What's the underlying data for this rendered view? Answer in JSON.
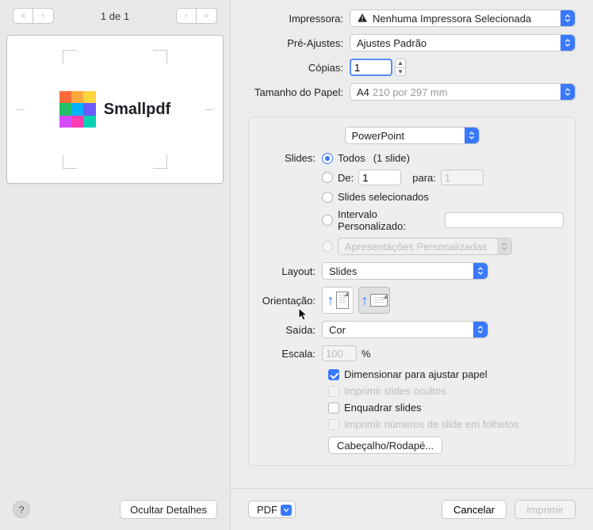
{
  "left": {
    "page_counter": "1 de 1",
    "brand": "Smallpdf",
    "logo_colors": [
      "#ff6a3d",
      "#ffa83d",
      "#ffd53d",
      "#22c06b",
      "#00b1ff",
      "#6a5cff",
      "#d64aff",
      "#ff3db0",
      "#00d1b2"
    ],
    "hide_details": "Ocultar Detalhes",
    "help": "?"
  },
  "printer": {
    "label": "Impressora:",
    "value": "Nenhuma Impressora Selecionada",
    "warning": true
  },
  "presets": {
    "label": "Pré-Ajustes:",
    "value": "Ajustes Padrão"
  },
  "copies": {
    "label": "Cópias:",
    "value": "1"
  },
  "paper": {
    "label": "Tamanho do Papel:",
    "value": "A4",
    "dim": "210 por 297 mm"
  },
  "module": {
    "value": "PowerPoint"
  },
  "slides": {
    "label": "Slides:",
    "options": {
      "all": {
        "label": "Todos",
        "note": "(1 slide)",
        "selected": true
      },
      "range": {
        "from_label": "De:",
        "from_value": "1",
        "to_label": "para:",
        "to_value": "1"
      },
      "selected": {
        "label": "Slides selecionados"
      },
      "custom": {
        "label": "Intervalo Personalizado:"
      },
      "custom_shows": {
        "label": "Apresentações Personalizadas"
      }
    }
  },
  "layout": {
    "label": "Layout:",
    "value": "Slides"
  },
  "orientation": {
    "label": "Orientação:",
    "value": "landscape"
  },
  "output": {
    "label": "Saída:",
    "value": "Cor"
  },
  "scale": {
    "label": "Escala:",
    "value": "100",
    "unit": "%"
  },
  "checks": {
    "fit": {
      "label": "Dimensionar para ajustar papel",
      "checked": true,
      "enabled": true
    },
    "hidden": {
      "label": "Imprimir slides ocultos",
      "checked": false,
      "enabled": false
    },
    "frame": {
      "label": "Enquadrar slides",
      "checked": false,
      "enabled": true
    },
    "numbers": {
      "label": "Imprimir números de slide em folhetos",
      "checked": false,
      "enabled": false
    }
  },
  "header_footer_btn": "Cabeçalho/Rodapé...",
  "footer": {
    "pdf": "PDF",
    "cancel": "Cancelar",
    "print": "Imprimir"
  }
}
